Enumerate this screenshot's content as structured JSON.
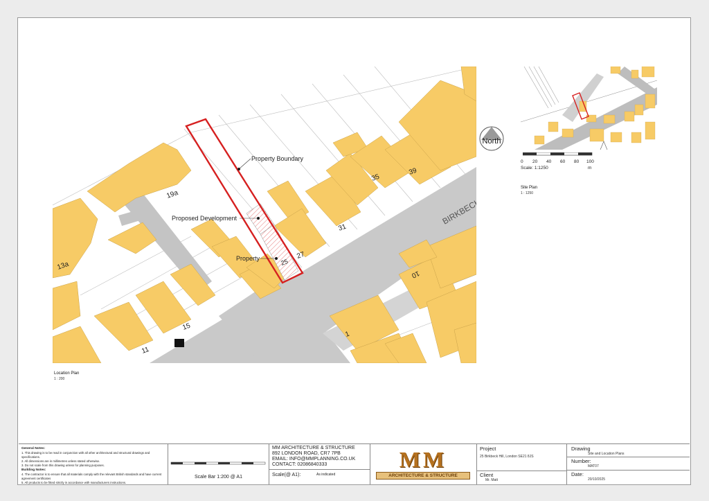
{
  "map": {
    "house_numbers": [
      "19a",
      "13a",
      "35",
      "39",
      "31",
      "27",
      "25",
      "15",
      "11",
      "10",
      "1"
    ],
    "street_label": "BIRKBECK",
    "callouts": {
      "property_boundary": "Property Boundary",
      "proposed_development": "Proposed Development",
      "property": "Property"
    },
    "north_label": "North",
    "caption_title": "Location Plan",
    "caption_scale": "1 : 200"
  },
  "site_plan": {
    "scale_ticks": [
      "0",
      "20",
      "40",
      "60",
      "80",
      "100"
    ],
    "scale_unit": "m",
    "scale_text": "Scale: 1:1250",
    "caption_title": "Site Plan",
    "caption_scale": "1 : 1250"
  },
  "title_block": {
    "general_notes_heading": "General Notes:",
    "general_notes": [
      "1. This drawing is to be read in conjunction with all other architectural and structural drawings and specifications.",
      "2. All dimensions are in millimetres unless stated otherwise.",
      "3. Do not scale from this drawing unless for planning purposes."
    ],
    "building_notes_heading": "Building Notes:",
    "building_notes": [
      "4. The contractor is to ensure that all materials comply with the relevant British standards and have current agreement certificates",
      "5. All products to be fitted strictly in accordance with manufacturers instructions."
    ],
    "scale_bar_label": "Scale Bar 1:200 @ A1",
    "firm_name": "MM ARCHITECTURE & STRUCTURE",
    "firm_address": "892 LONDON ROAD, CR7 7PB",
    "firm_email": "EMAIL: INFO@MMPLANNING.CO.UK",
    "firm_contact": "CONTACT: 02086840333",
    "scale_label": "Scale(@ A1):",
    "scale_value": "As indicated",
    "logo_letters": "MM",
    "logo_text": "ARCHITECTURE & STRUCTURE",
    "project_label": "Project",
    "project_value": "25 Birkbeck Hill, London SE21 8JS",
    "client_label": "Client",
    "client_value": "Mr. Matt",
    "drawing_label": "Drawing",
    "drawing_value": "Site and Location Plans",
    "number_label": "Number:",
    "number_value": "MAT07",
    "date_label": "Date:",
    "date_value": "20/10/2025"
  },
  "colors": {
    "building": "#f7cb66",
    "road": "#c8c8c8",
    "boundary": "#d62020"
  }
}
